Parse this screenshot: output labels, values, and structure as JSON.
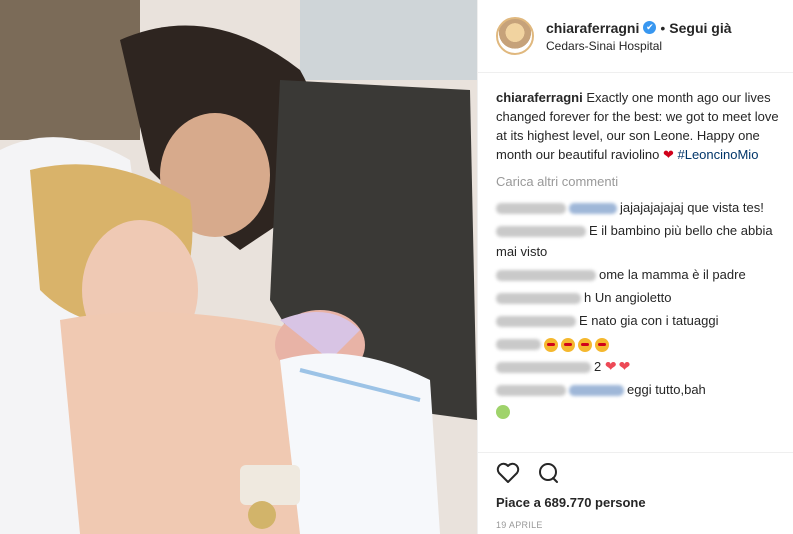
{
  "post": {
    "username": "chiaraferragni",
    "follow_label": "Segui già",
    "separator": "•",
    "location": "Cedars-Sinai Hospital",
    "verified_icon": "✔"
  },
  "caption": {
    "username": "chiaraferragni",
    "text": "Exactly one month ago our lives changed forever for the best: we got to meet love at its highest level, our son Leone. Happy one month our beautiful raviolino",
    "heart": "❤",
    "hashtag": "#LeoncinoMio"
  },
  "load_more": "Carica altri commenti",
  "comments": [
    {
      "text": "jajajajajajaj que vista tes!"
    },
    {
      "text": "E il bambino più bello che abbia mai visto"
    },
    {
      "text": "ome la mamma è il padre"
    },
    {
      "text": "h Un angioletto"
    },
    {
      "text": "E nato gia con i tatuaggi"
    },
    {
      "text": ""
    },
    {
      "text": "2"
    },
    {
      "text": "eggi tutto,bah"
    }
  ],
  "likes": "Piace a 689.770 persone",
  "date": "19 APRILE",
  "colors": {
    "link": "#003569",
    "verified": "#3897f0",
    "heart": "#ed4956"
  }
}
